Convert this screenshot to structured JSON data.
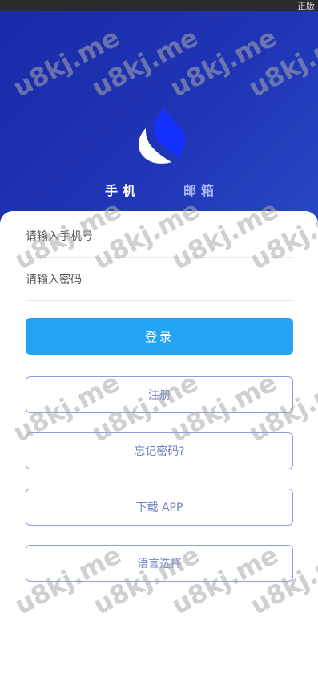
{
  "statusbar": {
    "label": "正版"
  },
  "tabs": [
    {
      "label": "手机",
      "active": true
    },
    {
      "label": "邮箱",
      "active": false
    }
  ],
  "form": {
    "phone_placeholder": "请输入手机号",
    "password_placeholder": "请输入密码"
  },
  "buttons": {
    "login": "登录",
    "register": "注册",
    "forgot": "忘记密码?",
    "download": "下载 APP",
    "language": "语言选择"
  },
  "watermark": {
    "text": "u8kj.me"
  },
  "colors": {
    "hero": "#1f35b6",
    "primary": "#24a3f2",
    "outline": "#8b9fe0",
    "logo_blue": "#1432ff"
  },
  "icons": {
    "logo": "flame-drop-logo-icon"
  }
}
